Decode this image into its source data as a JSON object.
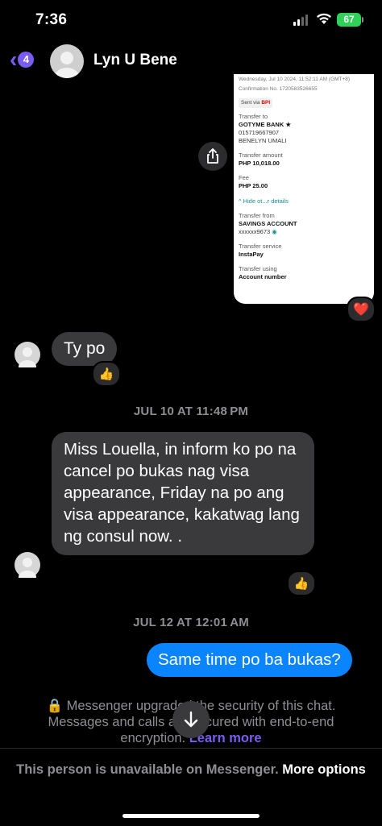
{
  "status_bar": {
    "time": "7:36",
    "battery": "67"
  },
  "header": {
    "unread_count": "4",
    "contact_name": "Lyn U Bene"
  },
  "receipt": {
    "date_line": "Wednesday, Jul 10 2024, 11:52:11 AM (GMT+8)",
    "confirmation": "Confirmation No. 1720583526655",
    "sent_via_prefix": "Sent via",
    "sent_via_bank": "BPI",
    "transfer_to_label": "Transfer to",
    "transfer_to_bank": "GOTYME BANK ★",
    "transfer_to_account": "015719667907",
    "transfer_to_name": "BENELYN UMALI",
    "amount_label": "Transfer amount",
    "amount_value": "PHP 10,018.00",
    "fee_label": "Fee",
    "fee_value": "PHP 25.00",
    "hide_details": "^  Hide ot...r details",
    "from_label": "Transfer from",
    "from_account_type": "SAVINGS ACCOUNT",
    "from_account_number": "xxxxxx9673",
    "service_label": "Transfer service",
    "service_value": "InstaPay",
    "using_label": "Transfer using",
    "using_value": "Account number"
  },
  "messages": {
    "ty": "Ty po",
    "ts1": "JUL 10 AT 11:48 PM",
    "long": "Miss Louella, in inform ko po na cancel po bukas nag visa appearance, Friday na po ang visa appearance, kakatwag lang ng consul now. .",
    "ts2": "JUL 12 AT 12:01 AM",
    "out": "Same time po ba bukas?"
  },
  "reactions": {
    "heart": "❤️",
    "thumbs": "👍"
  },
  "notice": {
    "text": "🔒 Messenger upgraded the security of this chat. Messages and calls are secured with end-to-end encryption.",
    "link": "Learn more"
  },
  "footer": {
    "text": "This person is unavailable on Messenger.",
    "link": "More options"
  },
  "colors": {
    "accent": "#7b5cf0",
    "outgoing": "#0a84ff",
    "incoming": "#3a3a3c"
  }
}
